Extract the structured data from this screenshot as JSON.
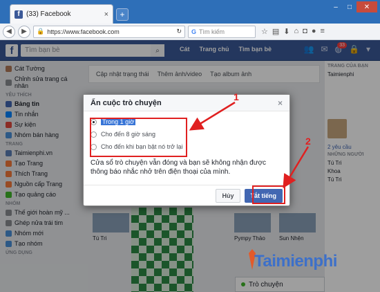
{
  "browser": {
    "tab_title": "(33) Facebook",
    "tab_close": "×",
    "new_tab": "+",
    "url": "https://www.facebook.com",
    "search_placeholder": "Tìm kiếm"
  },
  "fb": {
    "logo": "f",
    "search_placeholder": "Tìm bạn bè",
    "top_links": [
      "Cát",
      "Trang chủ",
      "Tìm bạn bè"
    ],
    "notification_count": "33"
  },
  "left_nav": {
    "profile_name": "Cát Tường",
    "edit_profile": "Chỉnh sửa trang cá nhân",
    "favorites_header": "YÊU THÍCH",
    "favorites": [
      "Bảng tin",
      "Tin nhắn",
      "Sự kiện",
      "Nhóm bán hàng"
    ],
    "pages_header": "TRANG",
    "pages": [
      "Taimienphi.vn",
      "Tạo Trang",
      "Thích Trang",
      "Nguồn cấp Trang",
      "Tạo quảng cáo"
    ],
    "groups_header": "NHÓM",
    "groups": [
      "Thế giới hoàn mỹ ...",
      "Ghép nửa trái tim",
      "Nhóm mới",
      "Tạo nhóm"
    ],
    "apps_header": "ỨNG DỤNG"
  },
  "composer": {
    "items": [
      "Cập nhật trạng thái",
      "Thêm ảnh/video",
      "Tạo album ảnh"
    ]
  },
  "cards": [
    {
      "name": "Tú Tri"
    },
    {
      "name": "Pympy Thảo"
    },
    {
      "name": "Sun Nhện"
    }
  ],
  "right_col": {
    "pages_header": "TRANG CỦA BẠN",
    "page_name": "Taimienphi",
    "suggested_header": "2 yêu cầu",
    "people_header": "NHỮNG NGƯỜI",
    "people": [
      "Tú Tri",
      "Khoa",
      "Tú Tri"
    ]
  },
  "chat": {
    "label": "Trò chuyện"
  },
  "dialog": {
    "title": "Ẩn cuộc trò chuyện",
    "close": "×",
    "options": [
      {
        "label": "Trong 1 giờ",
        "selected": true
      },
      {
        "label": "Cho đến 8 giờ sáng",
        "selected": false
      },
      {
        "label": "Cho đến khi bạn bật nó trở lại",
        "selected": false
      }
    ],
    "message": "Cửa sổ trò chuyện vẫn đóng và bạn sẽ không nhận được thông báo nhắc nhở trên điện thoại của mình.",
    "cancel": "Hủy",
    "confirm": "Tắt tiếng"
  },
  "annotations": {
    "one": "1",
    "two": "2"
  },
  "watermark": "Taimienphi",
  "colors": {
    "fb_blue": "#3b5998",
    "annotation_red": "#e02020"
  }
}
